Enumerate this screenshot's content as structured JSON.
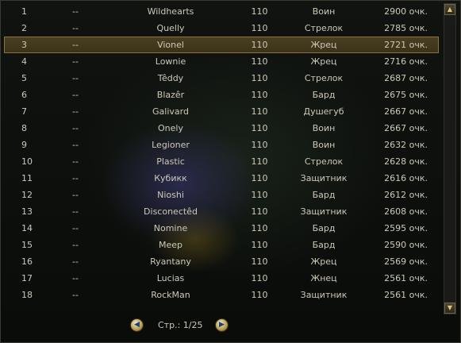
{
  "ranking": {
    "rows": [
      {
        "rank": "1",
        "dash": "--",
        "name": "Wildhearts",
        "level": "110",
        "class": "Воин",
        "score": "2900 очк."
      },
      {
        "rank": "2",
        "dash": "--",
        "name": "Quelly",
        "level": "110",
        "class": "Стрелок",
        "score": "2785 очк."
      },
      {
        "rank": "3",
        "dash": "--",
        "name": "Vionel",
        "level": "110",
        "class": "Жрец",
        "score": "2721 очк.",
        "selected": true
      },
      {
        "rank": "4",
        "dash": "--",
        "name": "Lownie",
        "level": "110",
        "class": "Жрец",
        "score": "2716 очк."
      },
      {
        "rank": "5",
        "dash": "--",
        "name": "Têddy",
        "level": "110",
        "class": "Стрелок",
        "score": "2687 очк."
      },
      {
        "rank": "6",
        "dash": "--",
        "name": "Blazêr",
        "level": "110",
        "class": "Бард",
        "score": "2675 очк."
      },
      {
        "rank": "7",
        "dash": "--",
        "name": "Galivard",
        "level": "110",
        "class": "Душегуб",
        "score": "2667 очк."
      },
      {
        "rank": "8",
        "dash": "--",
        "name": "Onely",
        "level": "110",
        "class": "Воин",
        "score": "2667 очк."
      },
      {
        "rank": "9",
        "dash": "--",
        "name": "Legioner",
        "level": "110",
        "class": "Воин",
        "score": "2632 очк."
      },
      {
        "rank": "10",
        "dash": "--",
        "name": "Plastic",
        "level": "110",
        "class": "Стрелок",
        "score": "2628 очк."
      },
      {
        "rank": "11",
        "dash": "--",
        "name": "Кубикк",
        "level": "110",
        "class": "Защитник",
        "score": "2616 очк."
      },
      {
        "rank": "12",
        "dash": "--",
        "name": "Nioshi",
        "level": "110",
        "class": "Бард",
        "score": "2612 очк."
      },
      {
        "rank": "13",
        "dash": "--",
        "name": "Disconectêd",
        "level": "110",
        "class": "Защитник",
        "score": "2608 очк."
      },
      {
        "rank": "14",
        "dash": "--",
        "name": "Nomine",
        "level": "110",
        "class": "Бард",
        "score": "2595 очк."
      },
      {
        "rank": "15",
        "dash": "--",
        "name": "Meep",
        "level": "110",
        "class": "Бард",
        "score": "2590 очк."
      },
      {
        "rank": "16",
        "dash": "--",
        "name": "Ryantany",
        "level": "110",
        "class": "Жрец",
        "score": "2569 очк."
      },
      {
        "rank": "17",
        "dash": "--",
        "name": "Lucias",
        "level": "110",
        "class": "Жнец",
        "score": "2561 очк."
      },
      {
        "rank": "18",
        "dash": "--",
        "name": "RockMan",
        "level": "110",
        "class": "Защитник",
        "score": "2561 очк."
      }
    ]
  },
  "pager": {
    "label": "Стр.: 1/25",
    "prev_icon": "arrow-left-icon",
    "next_icon": "arrow-right-icon"
  },
  "scrollbar": {
    "up_icon": "triangle-up-icon",
    "down_icon": "triangle-down-icon"
  },
  "colors": {
    "text": "#cdc9b8",
    "selected_row": "#4a3f22",
    "selected_border": "#8a7238",
    "button_gold": "#b69a4e",
    "arrow_blue": "#1d3f7a"
  }
}
